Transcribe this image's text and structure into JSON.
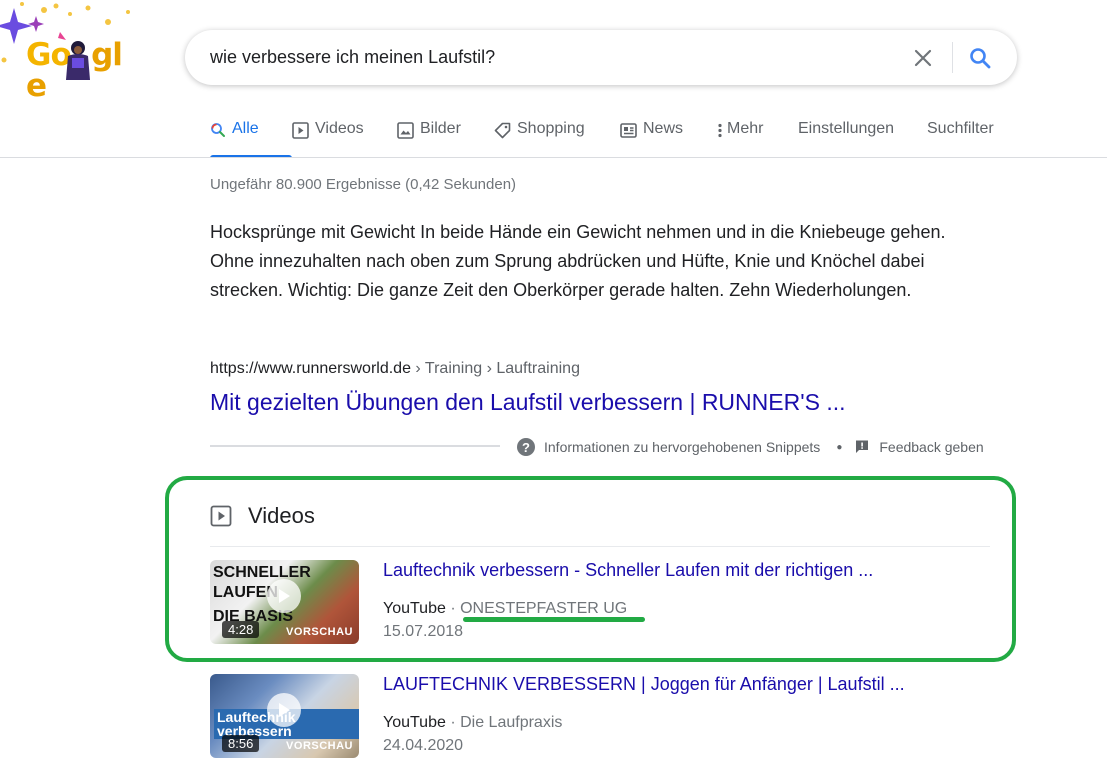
{
  "logo": {
    "text": "Google",
    "letters": [
      "G",
      "o",
      "o",
      "g",
      "l",
      "e"
    ]
  },
  "search": {
    "query": "wie verbessere ich meinen Laufstil?"
  },
  "tabs": [
    {
      "label": "Alle",
      "icon": "search-icon",
      "active": true
    },
    {
      "label": "Videos",
      "icon": "play-icon"
    },
    {
      "label": "Bilder",
      "icon": "image-icon"
    },
    {
      "label": "Shopping",
      "icon": "tag-icon"
    },
    {
      "label": "News",
      "icon": "newspaper-icon"
    },
    {
      "label": "Mehr",
      "icon": "more-vert-icon"
    },
    {
      "label": "Einstellungen"
    },
    {
      "label": "Suchfilter"
    }
  ],
  "result_stats": "Ungefähr 80.900 Ergebnisse (0,42 Sekunden)",
  "featured_snippet": {
    "text": "Hocksprünge mit Gewicht In beide Hände ein Gewicht nehmen und in die Kniebeuge gehen. Ohne innezuhalten nach oben zum Sprung abdrücken und Hüfte, Knie und Knöchel dabei strecken. Wichtig: Die ganze Zeit den Oberkörper gerade halten. Zehn Wiederholungen.",
    "cite_domain": "https://www.runnersworld.de",
    "cite_path": " › Training › Lauftraining",
    "title": "Mit gezielten Übungen den Laufstil verbessern | RUNNER'S ...",
    "info_label": "Informationen zu hervorgehobenen Snippets",
    "feedback_label": "Feedback geben"
  },
  "videos": {
    "heading": "Videos",
    "items": [
      {
        "title": "Lauftechnik verbessern - Schneller Laufen mit der richtigen ...",
        "source": "YouTube",
        "separator": " · ",
        "channel": "ONESTEPFASTER UG",
        "date": "15.07.2018",
        "duration": "4:28",
        "preview": "VORSCHAU",
        "thumb_text": [
          "SCHNELLER",
          "LAUFEN",
          "DIE BASIS"
        ]
      },
      {
        "title": "LAUFTECHNIK VERBESSERN | Joggen für Anfänger | Laufstil ...",
        "source": "YouTube",
        "separator": " · ",
        "channel": "Die Laufpraxis",
        "date": "24.04.2020",
        "duration": "8:56",
        "preview": "VORSCHAU",
        "thumb_text": [
          "Lauftechnik verbessern"
        ]
      }
    ]
  },
  "colors": {
    "link": "#1a0dab",
    "accent": "#1a73e8",
    "annotation_green": "#22aa44",
    "secondary_text": "#70757a"
  }
}
